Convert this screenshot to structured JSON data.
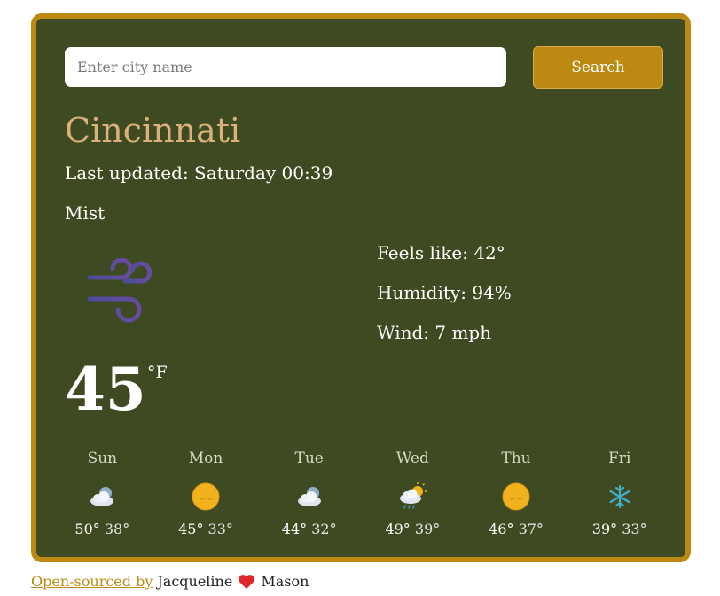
{
  "search": {
    "placeholder": "Enter city name",
    "value": "",
    "button_label": "Search"
  },
  "weather": {
    "city": "Cincinnati",
    "last_updated": "Last updated: Saturday 00:39",
    "condition": "Mist",
    "condition_icon": "mist-icon",
    "temperature": "45",
    "unit": "°F",
    "feels_like": "Feels like: 42°",
    "humidity": "Humidity: 94%",
    "wind": "Wind: 7 mph"
  },
  "forecast": [
    {
      "day": "Sun",
      "high": "50°",
      "low": "38°",
      "icon": "partly-cloudy-night-icon"
    },
    {
      "day": "Mon",
      "high": "45°",
      "low": "33°",
      "icon": "moon-icon"
    },
    {
      "day": "Tue",
      "high": "44°",
      "low": "32°",
      "icon": "partly-cloudy-night-icon"
    },
    {
      "day": "Wed",
      "high": "49°",
      "low": "39°",
      "icon": "rain-sun-icon"
    },
    {
      "day": "Thu",
      "high": "46°",
      "low": "37°",
      "icon": "moon-icon"
    },
    {
      "day": "Fri",
      "high": "39°",
      "low": "33°",
      "icon": "snowflake-icon"
    }
  ],
  "footer": {
    "link_text": "Open-sourced by",
    "author1": "Jacqueline",
    "author2": "Mason"
  },
  "colors": {
    "card_bg": "#3e4a22",
    "accent": "#bc8a12",
    "city": "#dcb07a",
    "heart": "#e0262b"
  }
}
